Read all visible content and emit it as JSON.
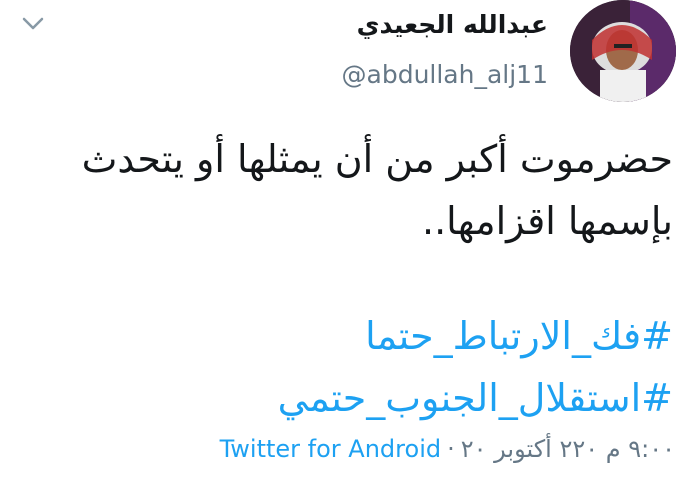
{
  "tweet": {
    "display_name": "عبدالله الجعيدي",
    "handle": "@abdullah_alj11",
    "text_line1": "حضرموت أكبر من أن يمثلها أو يتحدث",
    "text_line2": "بإسمها اقزامها..",
    "hashtags": [
      "#فك_الارتباط_حتما",
      "#استقلال_الجنوب_حتمي"
    ],
    "timestamp": "٩:٠٠ م ٢٢٠ أكتوبر ٢٠",
    "separator": "·",
    "source": "Twitter for Android"
  },
  "icons": {
    "menu": "chevron-down-icon"
  },
  "colors": {
    "link": "#1da1f2",
    "text": "#14171a",
    "muted": "#657786"
  }
}
